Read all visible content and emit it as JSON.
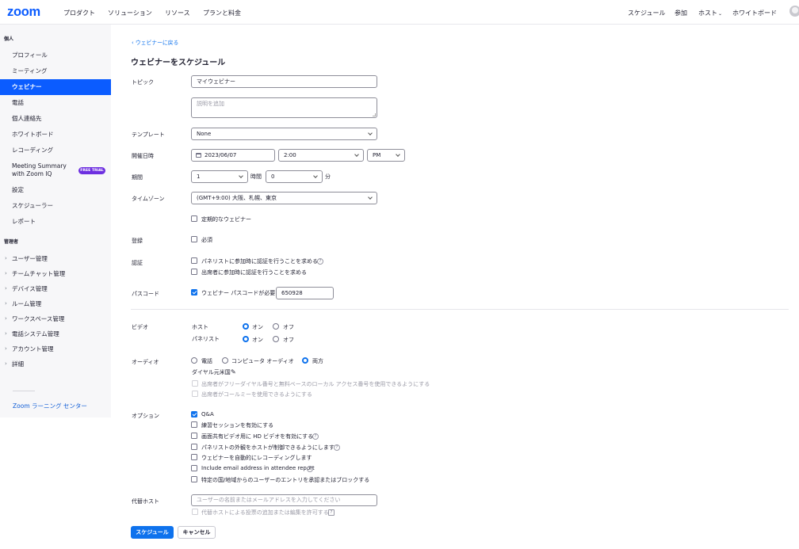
{
  "header": {
    "logo": "zoom",
    "nav_left": [
      "プロダクト",
      "ソリューション",
      "リソース",
      "プランと料金"
    ],
    "nav_right": [
      "スケジュール",
      "参加",
      "ホスト",
      "ホワイトボード"
    ]
  },
  "sidebar": {
    "personal_label": "個人",
    "personal_items": [
      "プロフィール",
      "ミーティング",
      "ウェビナー",
      "電話",
      "個人連絡先",
      "ホワイトボード",
      "レコーディング",
      "Meeting Summary with Zoom IQ",
      "設定",
      "スケジューラー",
      "レポート"
    ],
    "trial_badge": "FREE TRIAL",
    "admin_label": "管理者",
    "admin_items": [
      "ユーザー管理",
      "チームチャット管理",
      "デバイス管理",
      "ルーム管理",
      "ワークスペース管理",
      "電話システム管理",
      "アカウント管理",
      "詳細"
    ],
    "learning_center": "Zoom ラーニング センター"
  },
  "main": {
    "back_link": "ウェビナーに戻る",
    "title": "ウェビナーをスケジュール",
    "topic": {
      "label": "トピック",
      "value": "マイウェビナー",
      "description_placeholder": "説明を追加"
    },
    "template": {
      "label": "テンプレート",
      "value": "None"
    },
    "datetime": {
      "label": "開催日時",
      "date": "2023/06/07",
      "time": "2:00",
      "ampm": "PM"
    },
    "duration": {
      "label": "期間",
      "hours": "1",
      "hours_unit": "時間",
      "minutes": "0",
      "minutes_unit": "分"
    },
    "timezone": {
      "label": "タイムゾーン",
      "value": "(GMT+9:00) 大阪、札幌、東京"
    },
    "recurring": {
      "label": "定期的なウェビナー",
      "checked": false
    },
    "registration": {
      "label": "登録",
      "option": "必須",
      "checked": false
    },
    "auth": {
      "label": "認証",
      "panelist": "パネリストに参加時に認証を行うことを求める",
      "attendee": "出席者に参加時に認証を行うことを求める"
    },
    "passcode": {
      "label": "パスコード",
      "option": "ウェビナー パスコードが必要",
      "checked": true,
      "value": "650928"
    },
    "video": {
      "label": "ビデオ",
      "host": "ホスト",
      "panelist": "パネリスト",
      "on": "オン",
      "off": "オフ",
      "host_value": "オン",
      "panelist_value": "オン"
    },
    "audio": {
      "label": "オーディオ",
      "phone": "電話",
      "computer": "コンピュータ オーディオ",
      "both": "両方",
      "selected": "両方",
      "dial_from": "ダイヤル元米国",
      "toll_free": "出席者がフリーダイヤル番号と無料ベースのローカル アクセス番号を使用できるようにする",
      "call_me": "出席者がコールミーを使用できるようにする"
    },
    "options": {
      "label": "オプション",
      "items": [
        {
          "text": "Q&A",
          "checked": true
        },
        {
          "text": "練習セッションを有効にする",
          "checked": false
        },
        {
          "text": "画面共有ビデオ用に HD ビデオを有効にする",
          "checked": false
        },
        {
          "text": "パネリストの外観をホストが制御できるようにします",
          "checked": false
        },
        {
          "text": "ウェビナーを自動的にレコーディングします",
          "checked": false
        },
        {
          "text": "Include email address in attendee report",
          "checked": false
        },
        {
          "text": "特定の国/地域からのユーザーのエントリを承認またはブロックする",
          "checked": false
        }
      ]
    },
    "alt_host": {
      "label": "代替ホスト",
      "placeholder": "ユーザーの名前またはメールアドレスを入力してください",
      "sub_option": "代替ホストによる投票の追加または編集を許可する"
    },
    "buttons": {
      "schedule": "スケジュール",
      "cancel": "キャンセル"
    }
  }
}
